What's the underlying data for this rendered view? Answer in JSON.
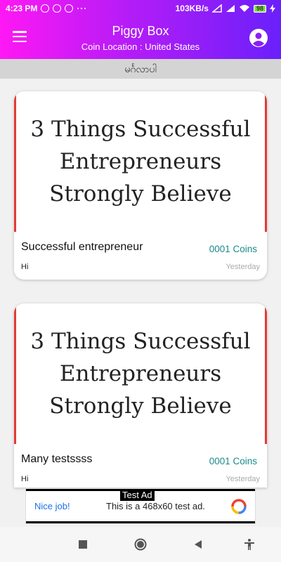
{
  "status_bar": {
    "time": "4:23 PM",
    "dots": "···",
    "network_speed": "103KB/s",
    "battery": "98"
  },
  "app_bar": {
    "title": "Piggy Box",
    "subtitle": "Coin Location : United States"
  },
  "category": {
    "label": "မင်္ဂလာပါ"
  },
  "cards": [
    {
      "image_text": "3 Things Successful Entrepreneurs Strongly Believe",
      "title": "Successful entrepreneur",
      "coins": "0001 Coins",
      "description": "Hi",
      "time": "Yesterday"
    },
    {
      "image_text": "3 Things Successful Entrepreneurs Strongly Believe",
      "title": "Many testssss",
      "coins": "0001 Coins",
      "description": "Hi",
      "time": "Yesterday"
    }
  ],
  "ad": {
    "label": "Test Ad",
    "nice": "Nice job!",
    "text": "This is a 468x60 test ad."
  },
  "colors": {
    "gradient_start": "#fe18f4",
    "gradient_end": "#6a20fa",
    "coins": "#1a8a8a",
    "card_edge": "#e53935"
  },
  "icons": {
    "menu": "hamburger-menu-icon",
    "account": "account-circle-icon",
    "nav_recent": "square-recents-icon",
    "nav_home": "circle-home-icon",
    "nav_back": "triangle-back-icon",
    "nav_accessibility": "accessibility-icon"
  }
}
